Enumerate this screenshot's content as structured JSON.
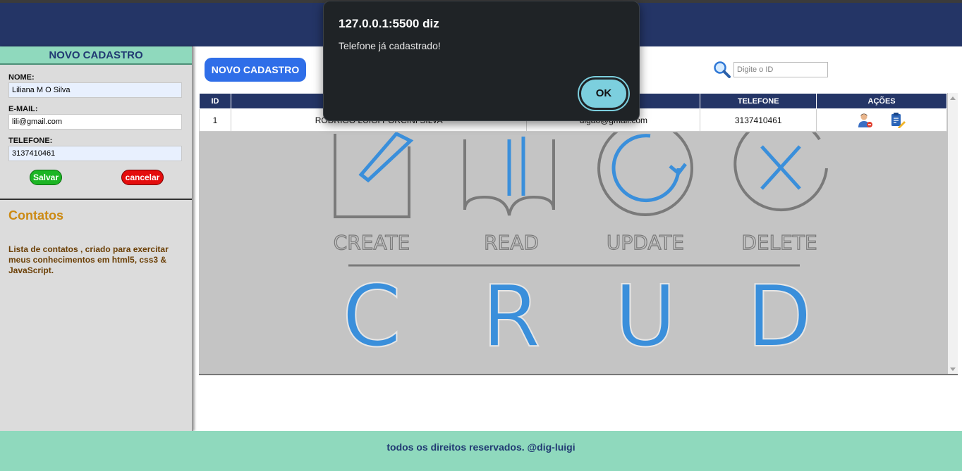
{
  "sidebar": {
    "title": "NOVO CADASTRO",
    "name_label": "NOME:",
    "name_value": "Liliana M O Silva",
    "email_label": "E-MAIL:",
    "email_value": "lili@gmail.com",
    "phone_label": "TELEFONE:",
    "phone_value": "3137410461",
    "save_label": "Salvar",
    "cancel_label": "cancelar",
    "contacts_title": "Contatos",
    "contacts_desc": "Lista de contatos , criado para exercitar meus conhecimentos em html5, css3 & JavaScript."
  },
  "main": {
    "new_button": "NOVO CADASTRO",
    "search_placeholder": "Digite o ID",
    "table": {
      "headers": {
        "id": "ID",
        "name": "",
        "email": "",
        "phone": "TELEFONE",
        "actions": "AÇÕES"
      },
      "rows": [
        {
          "id": "1",
          "name": "RODRIGO LUIGI PORCINI SILVA",
          "email": "digao@gmail.com",
          "phone": "3137410461"
        }
      ]
    },
    "banner": {
      "ops": [
        "CREATE",
        "READ",
        "UPDATE",
        "DELETE"
      ],
      "letters": [
        "C",
        "R",
        "U",
        "D"
      ]
    }
  },
  "footer": {
    "text": "todos os direitos reservados. @dig-luigi"
  },
  "dialog": {
    "title": "127.0.0.1:5500 diz",
    "message": "Telefone já cadastrado!",
    "ok_label": "OK"
  },
  "colors": {
    "header": "#243566",
    "mint": "#8fd9bd",
    "accent_blue": "#2f6ee8",
    "save_green": "#1cb524",
    "cancel_red": "#e40d0d",
    "crud_blue": "#3a8fdb"
  }
}
